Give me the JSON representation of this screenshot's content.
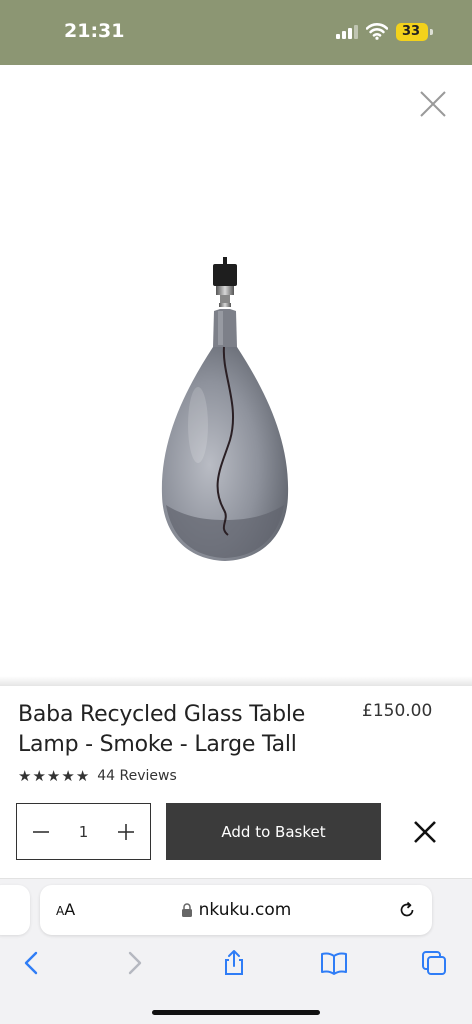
{
  "status_bar": {
    "time": "21:31",
    "battery": "33",
    "icons": [
      "signal-icon",
      "wifi-icon",
      "battery-icon"
    ],
    "background_color": "#8c9673"
  },
  "product": {
    "title": "Baba Recycled Glass Table Lamp - Smoke - Large Tall",
    "price": "£150.00",
    "rating_stars": 5,
    "reviews_label": "44 Reviews",
    "image_alt": "smoke glass table lamp"
  },
  "purchase": {
    "quantity": "1",
    "decrement_icon": "minus-icon",
    "increment_icon": "plus-icon",
    "add_to_basket_label": "Add to Basket",
    "button_color": "#3b3b3b"
  },
  "browser": {
    "text_size_label_small": "A",
    "text_size_label_big": "A",
    "url": "nkuku.com",
    "toolbar_icons": [
      "back-icon",
      "forward-icon",
      "share-icon",
      "bookmarks-icon",
      "tabs-icon"
    ],
    "accent_color": "#2f7df6"
  }
}
